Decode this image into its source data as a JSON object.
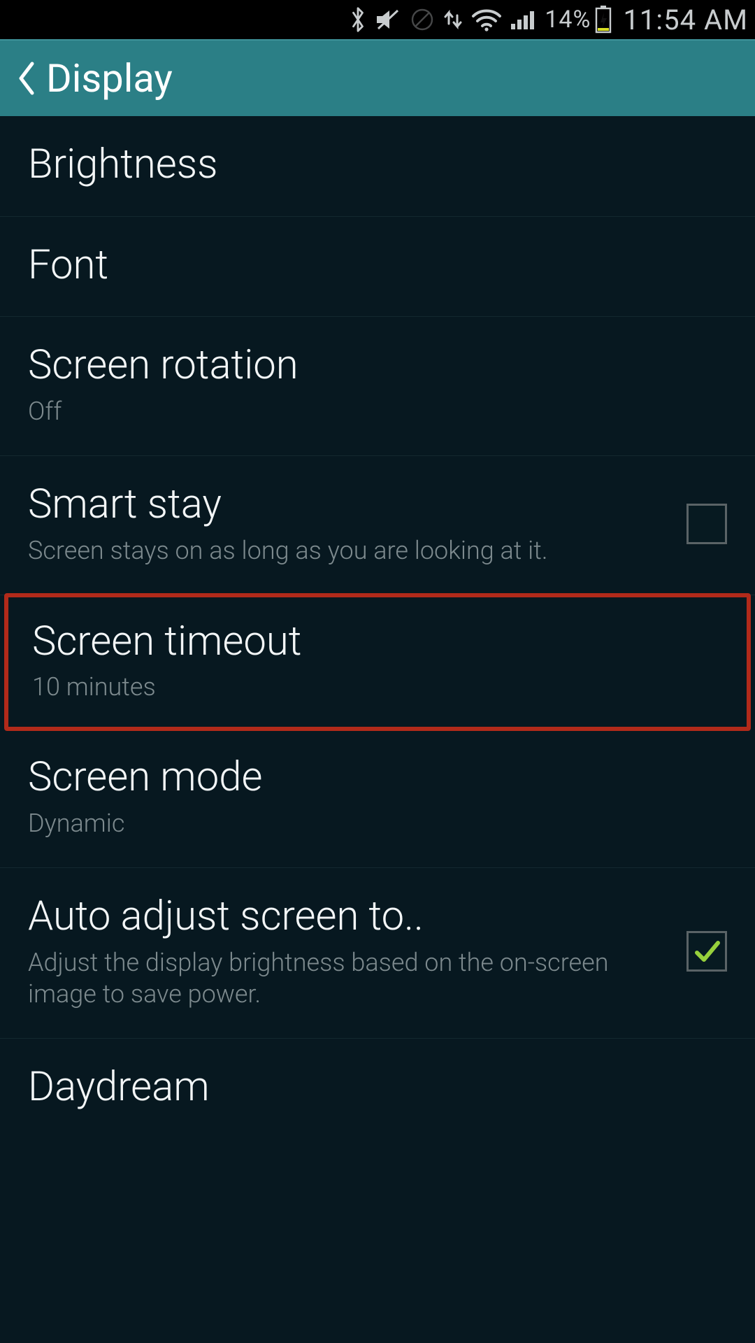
{
  "status": {
    "battery_pct": "14%",
    "clock": "11:54 AM"
  },
  "header": {
    "title": "Display"
  },
  "items": {
    "brightness": {
      "label": "Brightness"
    },
    "font": {
      "label": "Font"
    },
    "rotation": {
      "label": "Screen rotation",
      "sub": "Off"
    },
    "smart_stay": {
      "label": "Smart stay",
      "sub": "Screen stays on as long as you are looking at it."
    },
    "timeout": {
      "label": "Screen timeout",
      "sub": "10 minutes"
    },
    "mode": {
      "label": "Screen mode",
      "sub": "Dynamic"
    },
    "auto_adjust": {
      "label": "Auto adjust screen to..",
      "sub": "Adjust the display brightness based on the on‑screen image to save power."
    },
    "daydream": {
      "label": "Daydream"
    }
  }
}
